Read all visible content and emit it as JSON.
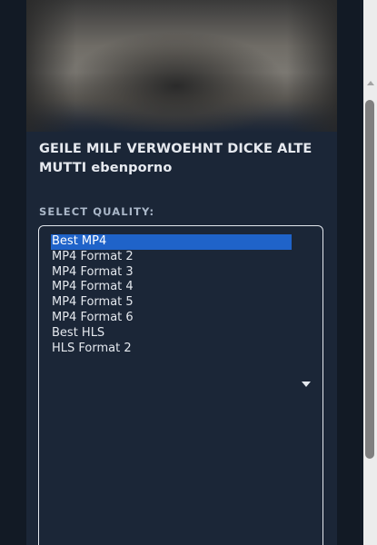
{
  "video": {
    "title": "GEILE MILF VERWOEHNT DICKE ALTE MUTTI ebenporno"
  },
  "quality": {
    "label": "SELECT QUALITY:",
    "options": [
      "Best MP4",
      "MP4 Format 2",
      "MP4 Format 3",
      "MP4 Format 4",
      "MP4 Format 5",
      "MP4 Format 6",
      "Best HLS",
      "HLS Format 2"
    ],
    "selected": "Best MP4"
  },
  "colors": {
    "card_background": "#1b2637",
    "selected_option": "#1f63c9",
    "text": "#e4e8ee",
    "label_text": "#aab7c8"
  }
}
